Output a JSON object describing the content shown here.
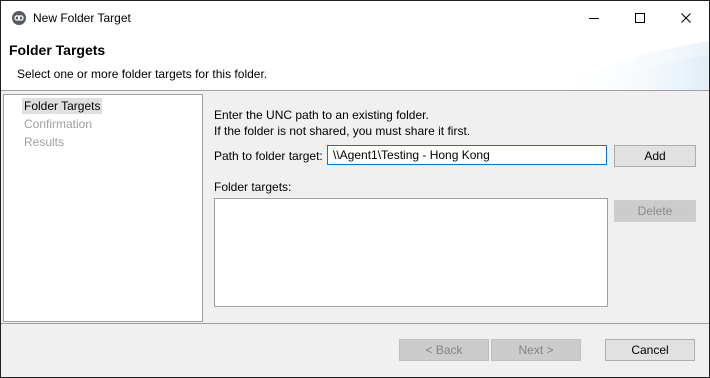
{
  "window": {
    "title": "New Folder Target",
    "app_icon": "peer-software-icon",
    "controls": [
      "minimize-icon",
      "maximize-icon",
      "close-icon"
    ]
  },
  "banner": {
    "title": "Folder Targets",
    "subtitle": "Select one or more folder targets for this folder."
  },
  "nav": {
    "items": [
      {
        "label": "Folder Targets",
        "state": "active"
      },
      {
        "label": "Confirmation",
        "state": "disabled"
      },
      {
        "label": "Results",
        "state": "disabled"
      }
    ]
  },
  "content": {
    "instruction_line1": "Enter the UNC path to an existing folder.",
    "instruction_line2": "If the folder is not shared, you must share it first.",
    "path_label": "Path to folder target:",
    "path_value": "\\\\Agent1\\Testing - Hong Kong",
    "add_label": "Add",
    "targets_label": "Folder targets:",
    "targets": [],
    "delete_label": "Delete"
  },
  "footer": {
    "back_label": "< Back",
    "next_label": "Next >",
    "cancel_label": "Cancel"
  },
  "colors": {
    "accent": "#0078d7",
    "dialog_bg": "#f0f0f0",
    "disabled_text": "#a0a0a0"
  }
}
